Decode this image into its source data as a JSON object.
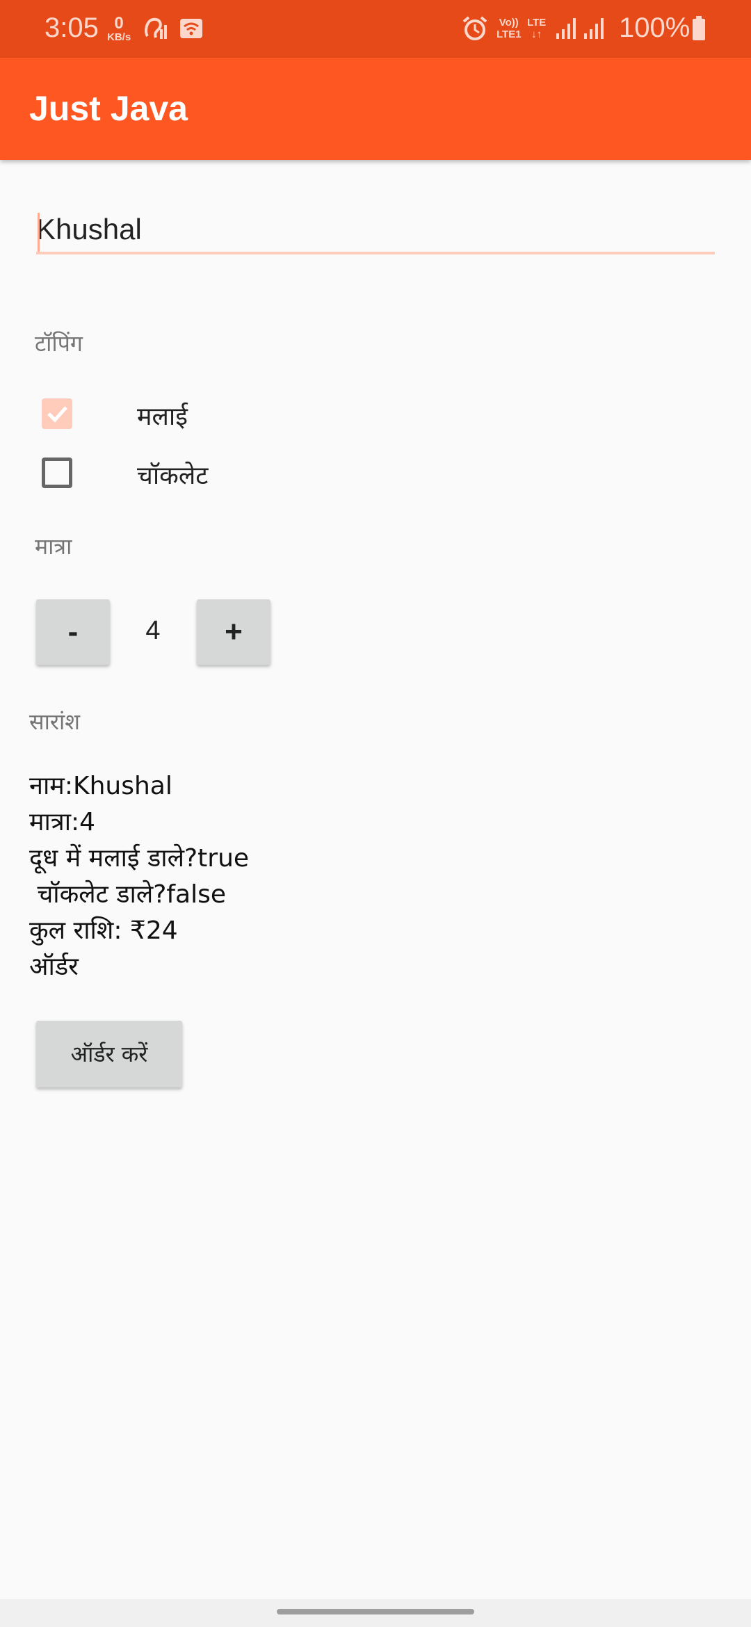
{
  "status_bar": {
    "time": "3:05",
    "net_speed_value": "0",
    "net_speed_unit": "KB/s",
    "volte_label": "Vo))",
    "lte1_label": "LTE1",
    "lte_label": "LTE",
    "battery": "100%",
    "icons": [
      "hearing-icon",
      "wifi-hotspot-icon",
      "alarm-icon",
      "signal-icon",
      "battery-icon"
    ]
  },
  "app_bar": {
    "title": "Just Java"
  },
  "form": {
    "name_value": "Khushal",
    "toppings_header": "टॉपिंग",
    "toppings": [
      {
        "label": "मलाई",
        "checked": true
      },
      {
        "label": "चॉकलेट",
        "checked": false
      }
    ],
    "quantity_header": "मात्रा",
    "decrement_label": "-",
    "quantity": "4",
    "increment_label": "+",
    "summary_header": "सारांश",
    "summary_lines": [
      "नाम:Khushal",
      "मात्रा:4",
      "दूध में मलाई डाले?true",
      " चॉकलेट डाले?false",
      "कुल राशि: ₹24",
      "ऑर्डर"
    ],
    "order_button_label": "ऑर्डर करें"
  },
  "colors": {
    "status_bar": "#e64a19",
    "app_bar": "#ff5722",
    "accent_light": "#ffccbc",
    "background": "#fafafa",
    "button": "#d6d7d7"
  }
}
